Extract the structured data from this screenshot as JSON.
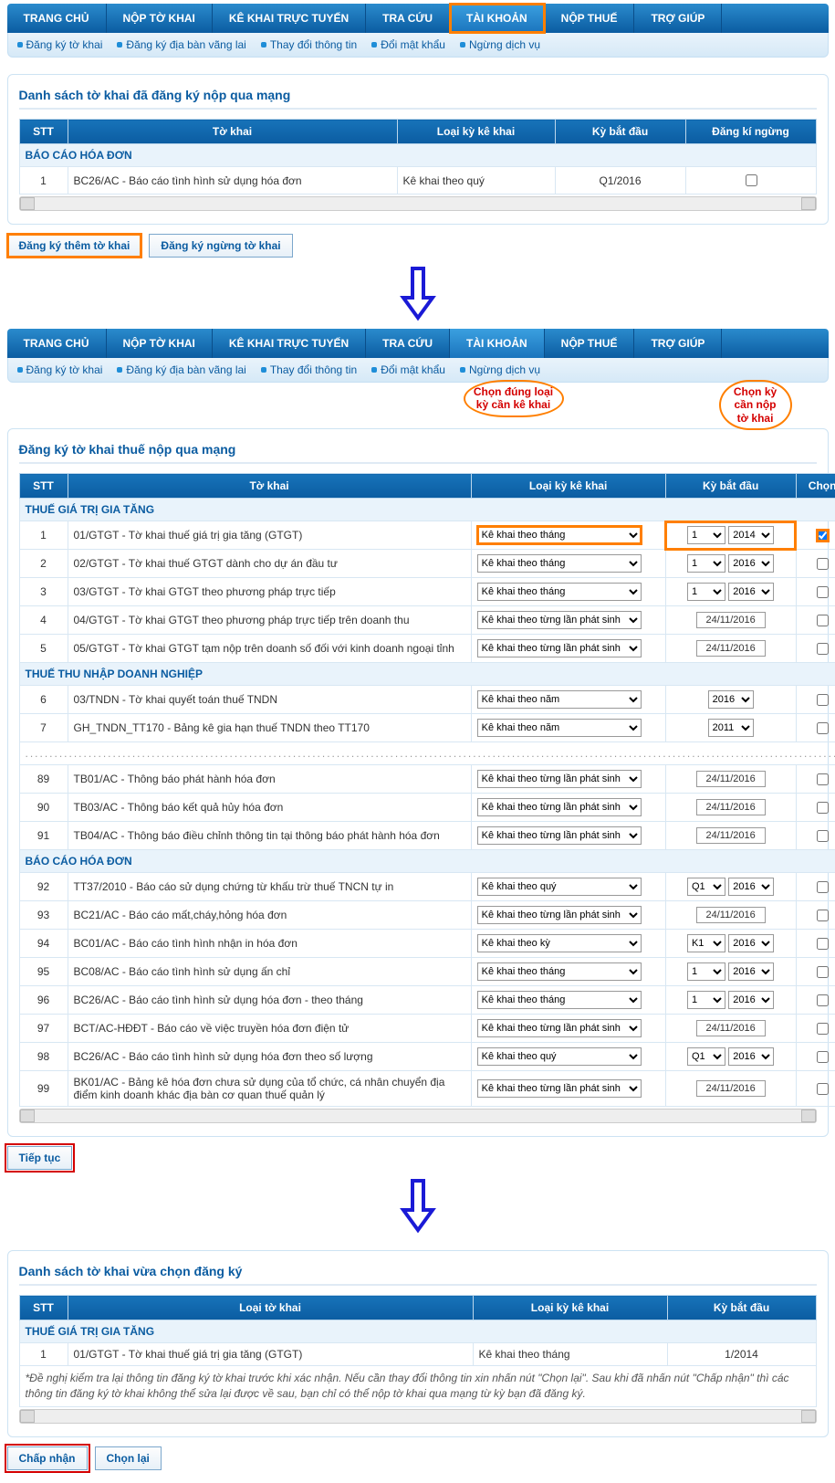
{
  "nav": {
    "tabs": [
      "TRANG CHỦ",
      "NỘP TỜ KHAI",
      "KÊ KHAI TRỰC TUYẾN",
      "TRA CỨU",
      "TÀI KHOẢN",
      "NỘP THUẾ",
      "TRỢ GIÚP"
    ],
    "active": "TÀI KHOẢN",
    "sub": [
      "Đăng ký tờ khai",
      "Đăng ký địa bàn vãng lai",
      "Thay đổi thông tin",
      "Đổi mật khẩu",
      "Ngừng dịch vụ"
    ]
  },
  "step1": {
    "title": "Danh sách tờ khai đã đăng ký nộp qua mạng",
    "headers": {
      "stt": "STT",
      "tokhai": "Tờ khai",
      "loai": "Loại kỳ kê khai",
      "batdau": "Kỳ bắt đầu",
      "ngung": "Đăng kí ngừng"
    },
    "cat": "BÁO CÁO HÓA ĐƠN",
    "row": {
      "stt": "1",
      "name": "BC26/AC - Báo cáo tình hình sử dụng hóa đơn",
      "loai": "Kê khai theo quý",
      "start": "Q1/2016"
    },
    "btn_more": "Đăng ký thêm tờ khai",
    "btn_stop": "Đăng ký ngừng tờ khai"
  },
  "step2": {
    "title": "Đăng ký tờ khai thuế nộp qua mạng",
    "headers": {
      "stt": "STT",
      "tokhai": "Tờ khai",
      "loai": "Loại kỳ kê khai",
      "batdau": "Kỳ bắt đầu",
      "chon": "Chọn"
    },
    "callout_loai": "Chọn đúng loại kỳ cần kê khai",
    "callout_ky": "Chọn kỳ cần nộp tờ khai",
    "cat1": "THUẾ GIÁ TRỊ GIA TĂNG",
    "cat2": "THUẾ THU NHẬP DOANH NGHIỆP",
    "cat3": "BÁO CÁO HÓA ĐƠN",
    "opt_month": "Kê khai theo tháng",
    "opt_year": "Kê khai theo năm",
    "opt_quarter": "Kê khai theo quý",
    "opt_period": "Kê khai theo kỳ",
    "opt_event": "Kê khai theo từng lần phát sinh",
    "rows1": [
      {
        "stt": "1",
        "name": "01/GTGT - Tờ khai thuế giá trị gia tăng (GTGT)",
        "sel": "opt_month",
        "mon": "1",
        "year": "2014",
        "chk": true,
        "hi": true
      },
      {
        "stt": "2",
        "name": "02/GTGT - Tờ khai thuế GTGT dành cho dự án đầu tư",
        "sel": "opt_month",
        "mon": "1",
        "year": "2016"
      },
      {
        "stt": "3",
        "name": "03/GTGT - Tờ khai GTGT theo phương pháp trực tiếp",
        "sel": "opt_month",
        "mon": "1",
        "year": "2016"
      },
      {
        "stt": "4",
        "name": "04/GTGT - Tờ khai GTGT theo phương pháp trực tiếp trên doanh thu",
        "sel": "opt_event",
        "date": "24/11/2016"
      },
      {
        "stt": "5",
        "name": "05/GTGT - Tờ khai GTGT tạm nộp trên doanh số đối với kinh doanh ngoại tỉnh",
        "sel": "opt_event",
        "date": "24/11/2016"
      }
    ],
    "rows2": [
      {
        "stt": "6",
        "name": "03/TNDN - Tờ khai quyết toán thuế TNDN",
        "sel": "opt_year",
        "year": "2016"
      },
      {
        "stt": "7",
        "name": "GH_TNDN_TT170 - Bảng kê gia hạn thuế TNDN theo TT170",
        "sel": "opt_year",
        "year": "2011"
      }
    ],
    "rows2b": [
      {
        "stt": "89",
        "name": "TB01/AC - Thông báo phát hành hóa đơn",
        "sel": "opt_event",
        "date": "24/11/2016"
      },
      {
        "stt": "90",
        "name": "TB03/AC - Thông báo kết quả hủy hóa đơn",
        "sel": "opt_event",
        "date": "24/11/2016"
      },
      {
        "stt": "91",
        "name": "TB04/AC - Thông báo điều chỉnh thông tin tại thông báo phát hành hóa đơn",
        "sel": "opt_event",
        "date": "24/11/2016"
      }
    ],
    "rows3": [
      {
        "stt": "92",
        "name": "TT37/2010 - Báo cáo sử dụng chứng từ khấu trừ thuế TNCN tự in",
        "sel": "opt_quarter",
        "mon": "Q1",
        "year": "2016"
      },
      {
        "stt": "93",
        "name": "BC21/AC - Báo cáo mất,cháy,hỏng hóa đơn",
        "sel": "opt_event",
        "date": "24/11/2016"
      },
      {
        "stt": "94",
        "name": "BC01/AC - Báo cáo tình hình nhận in hóa đơn",
        "sel": "opt_period",
        "mon": "K1",
        "year": "2016"
      },
      {
        "stt": "95",
        "name": "BC08/AC - Báo cáo tình hình sử dụng ấn chỉ",
        "sel": "opt_month",
        "mon": "1",
        "year": "2016"
      },
      {
        "stt": "96",
        "name": "BC26/AC - Báo cáo tình hình sử dụng hóa đơn - theo tháng",
        "sel": "opt_month",
        "mon": "1",
        "year": "2016"
      },
      {
        "stt": "97",
        "name": "BCT/AC-HĐĐT - Báo cáo về việc truyền hóa đơn điện tử",
        "sel": "opt_event",
        "date": "24/11/2016"
      },
      {
        "stt": "98",
        "name": "BC26/AC - Báo cáo tình hình sử dụng hóa đơn theo số lượng",
        "sel": "opt_quarter",
        "mon": "Q1",
        "year": "2016"
      },
      {
        "stt": "99",
        "name": "BK01/AC - Bảng kê hóa đơn chưa sử dụng của tổ chức, cá nhân chuyển địa điểm kinh doanh khác địa bàn cơ quan thuế quản lý",
        "sel": "opt_event",
        "date": "24/11/2016"
      }
    ],
    "btn_next": "Tiếp tục"
  },
  "step3": {
    "title": "Danh sách tờ khai vừa chọn đăng ký",
    "headers": {
      "stt": "STT",
      "tokhai": "Loại tờ khai",
      "loai": "Loại kỳ kê khai",
      "batdau": "Kỳ bắt đầu"
    },
    "cat": "THUẾ GIÁ TRỊ GIA TĂNG",
    "row": {
      "stt": "1",
      "name": "01/GTGT - Tờ khai thuế giá trị gia tăng (GTGT)",
      "loai": "Kê khai theo tháng",
      "start": "1/2014"
    },
    "note": "*Đề nghị kiểm tra lại thông tin đăng ký tờ khai trước khi xác nhận. Nếu cần thay đổi thông tin xin nhấn nút \"Chọn lại\".\nSau khi đã nhấn nút \"Chấp nhận\" thì các thông tin đăng ký tờ khai không thể sửa lại được về sau, bạn chỉ có thể nộp tờ khai qua mạng từ kỳ bạn đã đăng ký.",
    "btn_accept": "Chấp nhận",
    "btn_back": "Chọn lại"
  }
}
